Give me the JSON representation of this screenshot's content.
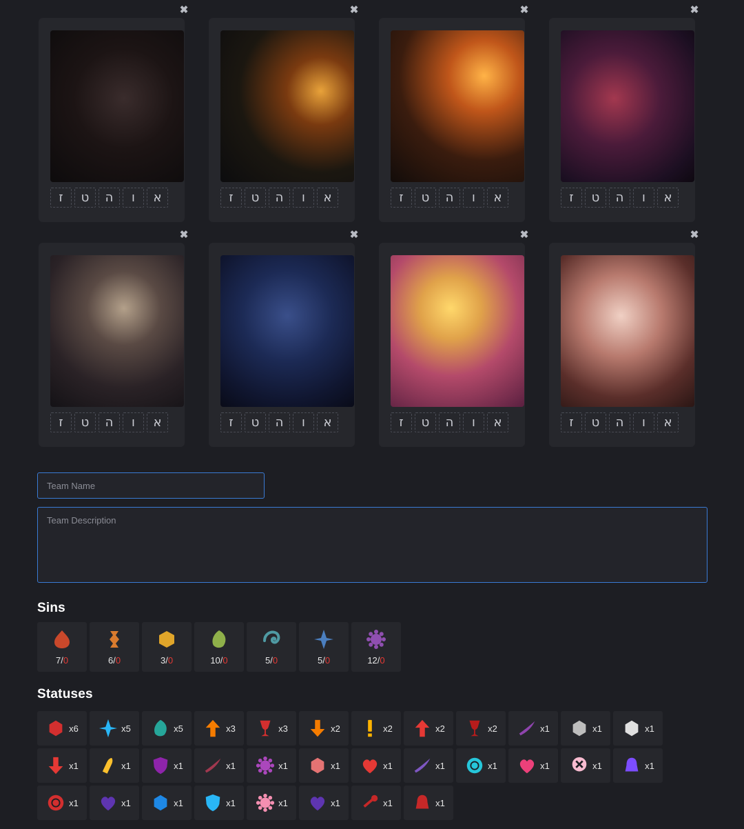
{
  "identities": [
    {
      "slots": [
        "ז",
        "ט",
        "ה",
        "ו",
        "א"
      ]
    },
    {
      "slots": [
        "ז",
        "ט",
        "ה",
        "ו",
        "א"
      ]
    },
    {
      "slots": [
        "ז",
        "ט",
        "ה",
        "ו",
        "א"
      ]
    },
    {
      "slots": [
        "ז",
        "ט",
        "ה",
        "ו",
        "א"
      ]
    },
    {
      "slots": [
        "ז",
        "ט",
        "ה",
        "ו",
        "א"
      ]
    },
    {
      "slots": [
        "ז",
        "ט",
        "ה",
        "ו",
        "א"
      ]
    },
    {
      "slots": [
        "ז",
        "ט",
        "ה",
        "ו",
        "א"
      ]
    },
    {
      "slots": [
        "ז",
        "ט",
        "ה",
        "ו",
        "א"
      ]
    }
  ],
  "close_glyph": "✖",
  "team_name": {
    "placeholder": "Team Name",
    "value": ""
  },
  "team_description": {
    "placeholder": "Team Description",
    "value": ""
  },
  "sins_title": "Sins",
  "sins": [
    {
      "icon": "wrath-icon",
      "count": "7",
      "sep": "/",
      "max": "0",
      "color": "#c9482b"
    },
    {
      "icon": "lust-icon",
      "count": "6",
      "sep": "/",
      "max": "0",
      "color": "#d97b2e"
    },
    {
      "icon": "sloth-icon",
      "count": "3",
      "sep": "/",
      "max": "0",
      "color": "#e0a52a"
    },
    {
      "icon": "gluttony-icon",
      "count": "10",
      "sep": "/",
      "max": "0",
      "color": "#8fb04a"
    },
    {
      "icon": "gloom-icon",
      "count": "5",
      "sep": "/",
      "max": "0",
      "color": "#4f9aa3"
    },
    {
      "icon": "pride-icon",
      "count": "5",
      "sep": "/",
      "max": "0",
      "color": "#4b7fc0"
    },
    {
      "icon": "envy-icon",
      "count": "12",
      "sep": "/",
      "max": "0",
      "color": "#8f4fb0"
    }
  ],
  "statuses_title": "Statuses",
  "statuses": [
    [
      {
        "icon": "bleed-icon",
        "count": "x6",
        "color": "#d32f2f"
      },
      {
        "icon": "shatter-icon",
        "count": "x5",
        "color": "#29b6f6"
      },
      {
        "icon": "leaf-icon",
        "count": "x5",
        "color": "#26a69a"
      },
      {
        "icon": "arrow-up-orange-icon",
        "count": "x3",
        "color": "#f57c00"
      },
      {
        "icon": "goblet-icon",
        "count": "x3",
        "color": "#d32f2f"
      },
      {
        "icon": "arrow-down-orange-icon",
        "count": "x2",
        "color": "#f57c00"
      },
      {
        "icon": "exclamation-icon",
        "count": "x2",
        "color": "#ffb300"
      },
      {
        "icon": "arrow-up-red-icon",
        "count": "x2",
        "color": "#e53935"
      },
      {
        "icon": "blood-goblet-icon",
        "count": "x2",
        "color": "#b71c1c"
      },
      {
        "icon": "purple-slash-icon",
        "count": "x1",
        "color": "#8e44ad"
      },
      {
        "icon": "skull-cross-icon",
        "count": "x1",
        "color": "#bdbdbd"
      },
      {
        "icon": "wolf-icon",
        "count": "x1",
        "color": "#e0e0e0"
      }
    ],
    [
      {
        "icon": "arrow-down-red-icon",
        "count": "x1",
        "color": "#e53935"
      },
      {
        "icon": "bullet-icon",
        "count": "x1",
        "color": "#fbc02d"
      },
      {
        "icon": "purple-shield-icon",
        "count": "x1",
        "color": "#8e24aa"
      },
      {
        "icon": "dark-feather-icon",
        "count": "x1",
        "color": "#a1384f"
      },
      {
        "icon": "purple-burst-icon",
        "count": "x1",
        "color": "#ab47bc"
      },
      {
        "icon": "pointing-hand-icon",
        "count": "x1",
        "color": "#e57373"
      },
      {
        "icon": "cracked-heart-icon",
        "count": "x1",
        "color": "#e53935"
      },
      {
        "icon": "violet-claw-icon",
        "count": "x1",
        "color": "#7e57c2"
      },
      {
        "icon": "cyan-orb-icon",
        "count": "x1",
        "color": "#26c6da"
      },
      {
        "icon": "heart-mask-icon",
        "count": "x1",
        "color": "#ec407a"
      },
      {
        "icon": "speech-x-icon",
        "count": "x1",
        "color": "#f8bbd0"
      },
      {
        "icon": "hooded-figure-icon",
        "count": "x1",
        "color": "#7c4dff"
      }
    ],
    [
      {
        "icon": "red-seal-icon",
        "count": "x1",
        "color": "#d32f2f"
      },
      {
        "icon": "broken-heart-icon",
        "count": "x1",
        "color": "#5e35b1"
      },
      {
        "icon": "blue-beast-icon",
        "count": "x1",
        "color": "#1e88e5"
      },
      {
        "icon": "shield-plus-icon",
        "count": "x1",
        "color": "#29b6f6"
      },
      {
        "icon": "flower-icon",
        "count": "x1",
        "color": "#f48fb1"
      },
      {
        "icon": "hearts-icon",
        "count": "x1",
        "color": "#5e35b1"
      },
      {
        "icon": "red-key-icon",
        "count": "x1",
        "color": "#c62828"
      },
      {
        "icon": "red-bell-icon",
        "count": "x1",
        "color": "#c62828"
      }
    ]
  ]
}
